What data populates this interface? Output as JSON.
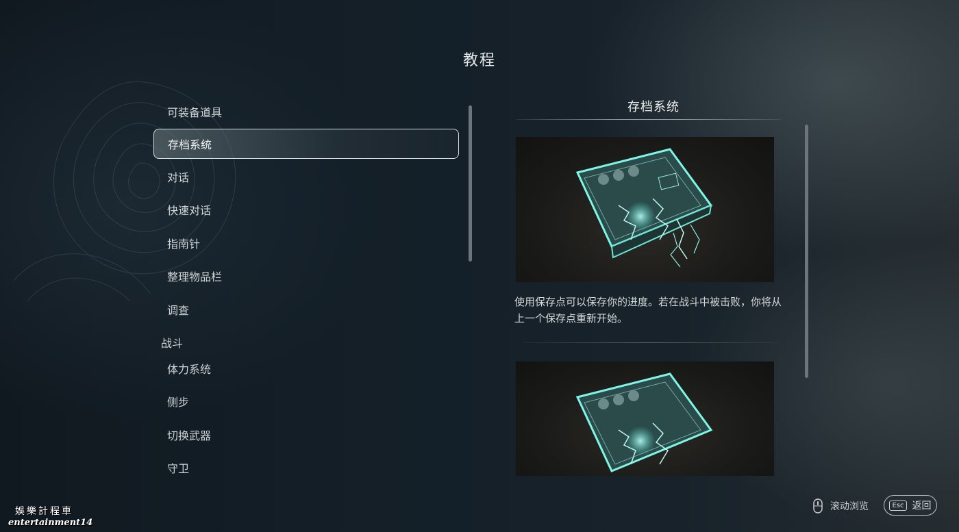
{
  "header": {
    "title": "教程"
  },
  "menu": {
    "items": [
      {
        "label": "可装备道具",
        "type": "item"
      },
      {
        "label": "存档系统",
        "type": "item",
        "selected": true
      },
      {
        "label": "对话",
        "type": "item"
      },
      {
        "label": "快速对话",
        "type": "item"
      },
      {
        "label": "指南针",
        "type": "item"
      },
      {
        "label": "整理物品栏",
        "type": "item"
      },
      {
        "label": "调查",
        "type": "item"
      },
      {
        "label": "战斗",
        "type": "category"
      },
      {
        "label": "体力系统",
        "type": "item"
      },
      {
        "label": "侧步",
        "type": "item"
      },
      {
        "label": "切换武器",
        "type": "item"
      },
      {
        "label": "守卫",
        "type": "item"
      }
    ]
  },
  "detail": {
    "title": "存档系统",
    "description": "使用保存点可以保存你的进度。若在战斗中被击败，你将从上一个保存点重新开始。"
  },
  "footer": {
    "scroll_label": "滚动浏览",
    "esc_key": "Esc",
    "back_label": "返回",
    "scroll_icon": "mouse-scroll-icon"
  },
  "watermark": {
    "line1": "娛樂計程車",
    "line2": "entertainment14"
  },
  "colors": {
    "background": "#121a21",
    "accent_glow": "#7ff5e6",
    "selected_border": "#d8dcdc"
  }
}
